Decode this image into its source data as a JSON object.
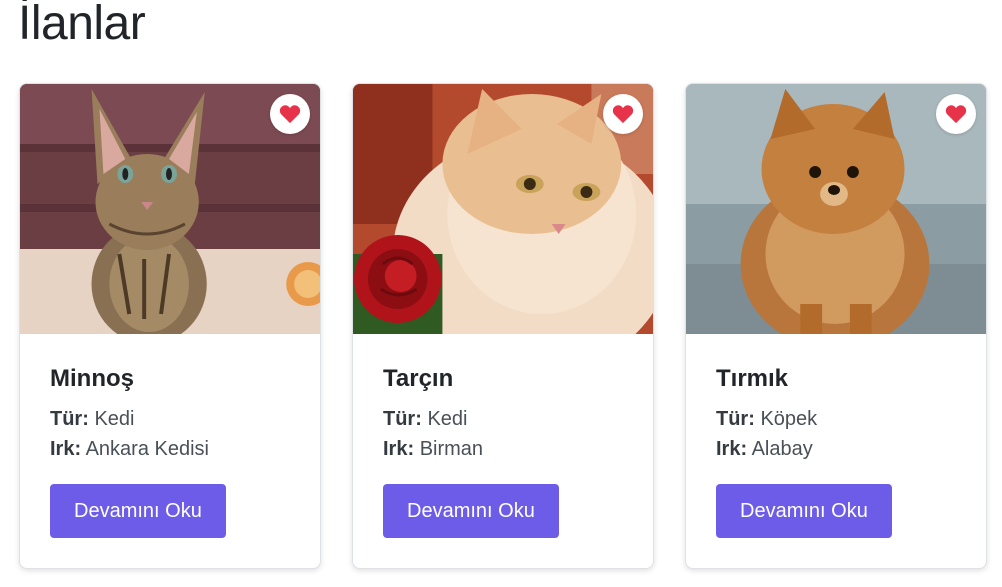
{
  "page": {
    "title": "İlanlar"
  },
  "labels": {
    "type": "Tür:",
    "breed": "Irk:"
  },
  "colors": {
    "accent": "#6c5ce7",
    "heart": "#e6334a"
  },
  "cards": [
    {
      "name": "Minnoş",
      "type": "Kedi",
      "breed": "Ankara Kedisi",
      "button": "Devamını Oku",
      "photo": "tabby-kitten-photo"
    },
    {
      "name": "Tarçın",
      "type": "Kedi",
      "breed": "Birman",
      "button": "Devamını Oku",
      "photo": "fluffy-cat-with-rose-photo"
    },
    {
      "name": "Tırmık",
      "type": "Köpek",
      "breed": "Alabay",
      "button": "Devamını Oku",
      "photo": "pomeranian-dog-photo"
    }
  ]
}
